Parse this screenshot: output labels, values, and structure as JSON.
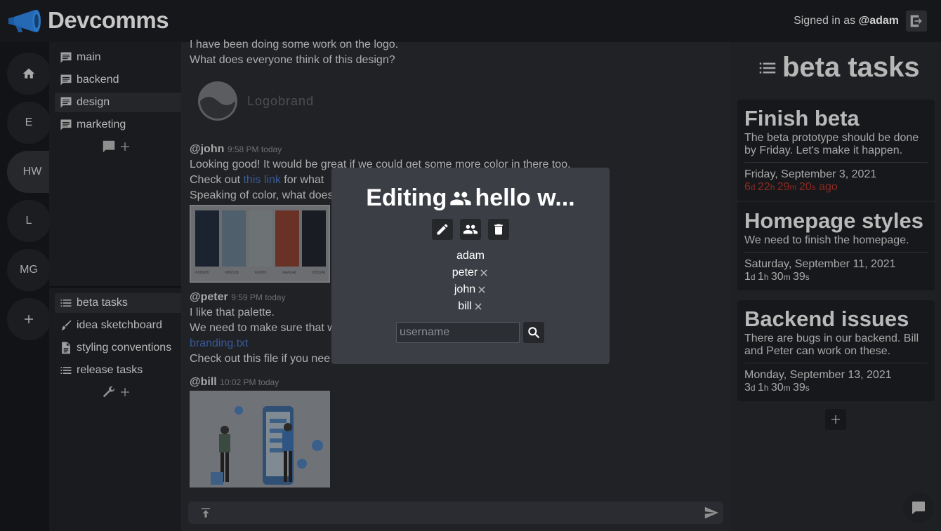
{
  "header": {
    "app_name": "Devcomms",
    "signed_in_prefix": "Signed in as",
    "username": "@adam"
  },
  "servers": [
    {
      "label": "",
      "icon": "home-icon"
    },
    {
      "label": "E"
    },
    {
      "label": "HW"
    },
    {
      "label": "L"
    },
    {
      "label": "MG"
    },
    {
      "label": "",
      "icon": "plus-icon"
    }
  ],
  "channels": [
    {
      "label": "main",
      "icon": "chat-icon"
    },
    {
      "label": "backend",
      "icon": "chat-icon"
    },
    {
      "label": "design",
      "icon": "chat-icon"
    },
    {
      "label": "marketing",
      "icon": "chat-icon"
    }
  ],
  "tools": [
    {
      "label": "beta tasks",
      "icon": "list-icon"
    },
    {
      "label": "idea sketchboard",
      "icon": "brush-icon"
    },
    {
      "label": "styling conventions",
      "icon": "document-icon"
    },
    {
      "label": "release tasks",
      "icon": "list-icon"
    }
  ],
  "chat": {
    "msg_top_1": "I have been doing some work on the logo.",
    "msg_top_2": "What does everyone think of this design?",
    "logo_brand": "Logobrand",
    "john": {
      "author": "@john",
      "time": "9:58 PM today",
      "line1": "Looking good! It would be great if we could get some more color in there too.",
      "line2_a": "Check out ",
      "line2_link": "this link",
      "line2_b": " for what",
      "line3": "Speaking of color, what does"
    },
    "palette_labels": [
      "#2d3e50",
      "#90c1d9",
      "#e0f0fc",
      "#ee6c4d",
      "#293241"
    ],
    "peter": {
      "author": "@peter",
      "time": "9:59 PM today",
      "line1": "I like that palette.",
      "line2": "We need to make sure that w",
      "file_link": "branding.txt",
      "line3": "Check out this file if you nee"
    },
    "bill": {
      "author": "@bill",
      "time": "10:02 PM today"
    }
  },
  "tasks_panel": {
    "title": "beta tasks",
    "tasks": [
      {
        "title": "Finish beta",
        "desc": "The beta prototype should be done by Friday. Let's make it happen.",
        "date": "Friday, September 3, 2021",
        "d": "6",
        "h": "22",
        "m": "29",
        "s": "20",
        "suffix": " ago",
        "overdue": true
      },
      {
        "title": "Homepage styles",
        "desc": "We need to finish the homepage.",
        "date": "Saturday, September 11, 2021",
        "d": "1",
        "h": "1",
        "m": "30",
        "s": "39",
        "suffix": "",
        "overdue": false
      },
      {
        "title": "Backend issues",
        "desc": "There are bugs in our backend. Bill and Peter can work on these.",
        "date": "Monday, September 13, 2021",
        "d": "3",
        "h": "1",
        "m": "30",
        "s": "39",
        "suffix": "",
        "overdue": false
      }
    ]
  },
  "modal": {
    "title_prefix": "Editing",
    "title_name": "hello w...",
    "members": [
      "adam",
      "peter",
      "john",
      "bill"
    ],
    "search_placeholder": "username"
  },
  "colors": {
    "accent_blue": "#4a8fd6",
    "overdue_red": "#8b2a22",
    "modal_bg": "#3b3f45"
  }
}
